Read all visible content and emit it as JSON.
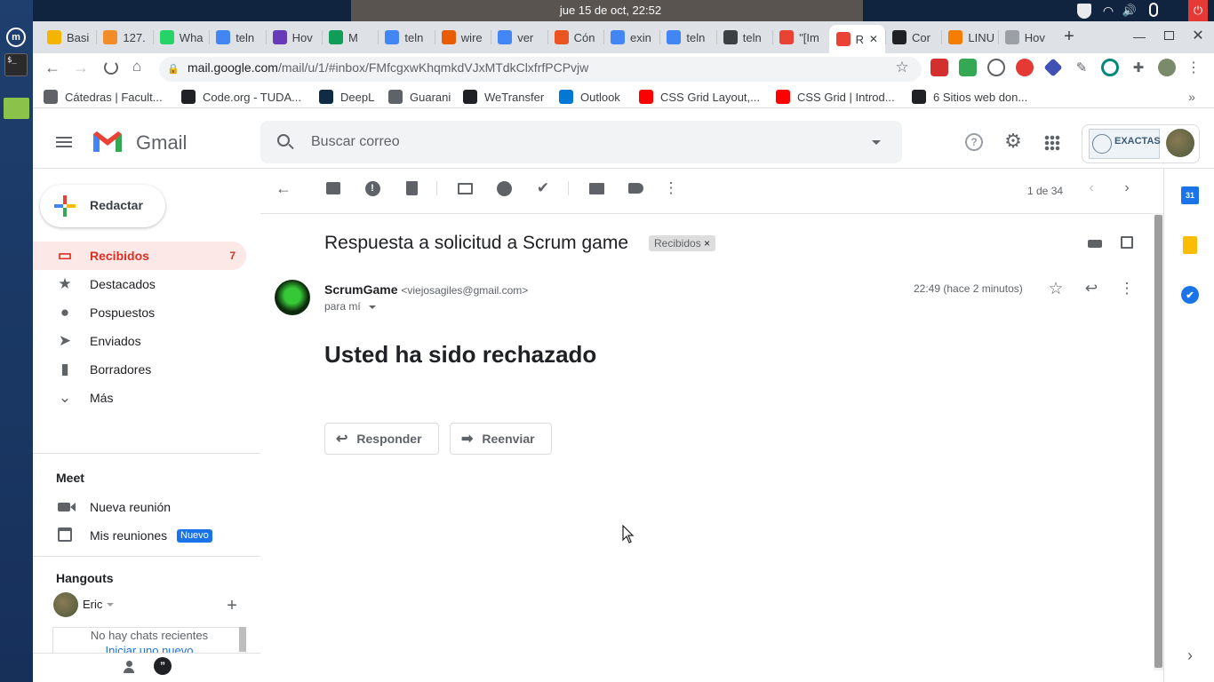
{
  "system": {
    "clock": "jue 15 de oct, 22:52"
  },
  "tabs": [
    {
      "label": "Basi",
      "icon": "sun-icon",
      "color": "#f5b400"
    },
    {
      "label": "127.",
      "icon": "pma-icon",
      "color": "#f28c28"
    },
    {
      "label": "Wha",
      "icon": "whatsapp-icon",
      "color": "#25d366"
    },
    {
      "label": "teln",
      "icon": "quora-icon",
      "color": "#4285f4"
    },
    {
      "label": "Hov",
      "icon": "howto-icon",
      "color": "#673ab7"
    },
    {
      "label": "M",
      "icon": "chat-icon",
      "color": "#0f9d58"
    },
    {
      "label": "teln",
      "icon": "quora-icon",
      "color": "#4285f4"
    },
    {
      "label": "wire",
      "icon": "ask-icon",
      "color": "#e85d04"
    },
    {
      "label": "ver",
      "icon": "quora-icon",
      "color": "#4285f4"
    },
    {
      "label": "Cón",
      "icon": "ubuntu-icon",
      "color": "#e95420"
    },
    {
      "label": "exin",
      "icon": "quora-icon",
      "color": "#4285f4"
    },
    {
      "label": "teln",
      "icon": "quora-icon",
      "color": "#4285f4"
    },
    {
      "label": "teln",
      "icon": "diamond-icon",
      "color": "#3c4043"
    },
    {
      "label": "\"[Im",
      "icon": "gmail-icon",
      "color": "#ea4335"
    },
    {
      "label": "R",
      "icon": "gmail-icon",
      "color": "#ea4335"
    },
    {
      "label": "Cor",
      "icon": "codepen-icon",
      "color": "#202124"
    },
    {
      "label": "LINU",
      "icon": "blogger-icon",
      "color": "#f57d00"
    },
    {
      "label": "Hov",
      "icon": "page-icon",
      "color": "#9aa0a6"
    }
  ],
  "address": {
    "domain": "mail.google.com",
    "path": "/mail/u/1/#inbox/FMfcgxwKhqmkdVJxMTdkClxfrfPCPvjw"
  },
  "bookmarks": [
    {
      "label": "Cátedras | Facult...",
      "icon": "page-icon",
      "color": "#5f6368"
    },
    {
      "label": "Code.org - TUDA...",
      "icon": "code-icon",
      "color": "#202124"
    },
    {
      "label": "DeepL",
      "icon": "deepl-icon",
      "color": "#0f2b46"
    },
    {
      "label": "Guarani",
      "icon": "globe-icon",
      "color": "#5f6368"
    },
    {
      "label": "WeTransfer",
      "icon": "wetransfer-icon",
      "color": "#202124"
    },
    {
      "label": "Outlook",
      "icon": "microsoft-icon",
      "color": "#0078d4"
    },
    {
      "label": "CSS Grid Layout,...",
      "icon": "youtube-icon",
      "color": "#ff0000"
    },
    {
      "label": "CSS Grid | Introd...",
      "icon": "youtube-icon",
      "color": "#ff0000"
    },
    {
      "label": "6 Sitios web don...",
      "icon": "fm-icon",
      "color": "#202124"
    }
  ],
  "gmail": {
    "product": "Gmail",
    "search_placeholder": "Buscar correo",
    "compose": "Redactar",
    "nav": [
      {
        "label": "Recibidos",
        "count": "7",
        "icon": "inbox-icon"
      },
      {
        "label": "Destacados",
        "count": "",
        "icon": "star-icon"
      },
      {
        "label": "Pospuestos",
        "count": "",
        "icon": "clock-icon"
      },
      {
        "label": "Enviados",
        "count": "",
        "icon": "send-icon"
      },
      {
        "label": "Borradores",
        "count": "",
        "icon": "draft-icon"
      },
      {
        "label": "Más",
        "count": "",
        "icon": "chevron-down-icon"
      }
    ],
    "meet": {
      "title": "Meet",
      "new_meeting": "Nueva reunión",
      "my_meetings": "Mis reuniones",
      "new_badge": "Nuevo"
    },
    "hangouts": {
      "title": "Hangouts",
      "user": "Eric",
      "no_chats": "No hay chats recientes",
      "start_new": "Iniciar uno nuevo"
    },
    "pagination": "1 de 34"
  },
  "email": {
    "subject": "Respuesta a solicitud a Scrum game",
    "label_chip": "Recibidos",
    "sender_name": "ScrumGame",
    "sender_email": "<viejosagiles@gmail.com>",
    "to": "para mí",
    "time": "22:49 (hace 2 minutos)",
    "body": "Usted ha sido rechazado",
    "reply": "Responder",
    "forward": "Reenviar"
  },
  "account": {
    "org_name": "EXACTAS"
  },
  "colors": {
    "accent_red": "#d93025",
    "selected_bg": "#fce8e6",
    "badge_blue": "#1a73e8"
  }
}
